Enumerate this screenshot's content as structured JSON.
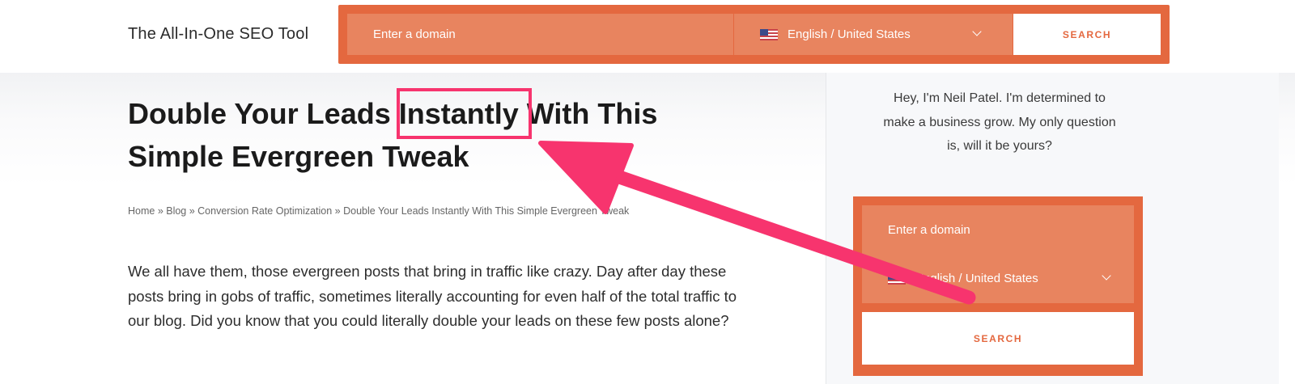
{
  "header": {
    "tagline": "The All-In-One SEO Tool",
    "domain_placeholder": "Enter a domain",
    "language": "English / United States",
    "search_label": "SEARCH"
  },
  "article": {
    "title": "Double Your Leads Instantly With This Simple Evergreen Tweak",
    "breadcrumb": "Home » Blog » Conversion Rate Optimization » Double Your Leads Instantly With This Simple Evergreen Tweak",
    "intro": "We all have them, those evergreen posts that bring in traffic like crazy. Day after day these posts bring in gobs of traffic, sometimes literally accounting for even half of the total traffic to our blog. Did you know that you could literally double your leads on these few posts alone?"
  },
  "sidebar": {
    "bio": "Hey, I'm Neil Patel. I'm determined to make a business grow. My only question is, will it be yours?",
    "domain_placeholder": "Enter a domain",
    "language": "English / United States",
    "search_label": "SEARCH"
  },
  "annotation": {
    "color": "#f7346e",
    "highlighted_word": "Instantly"
  },
  "colors": {
    "brand_orange": "#e4683f",
    "field_orange": "#e8845f"
  }
}
